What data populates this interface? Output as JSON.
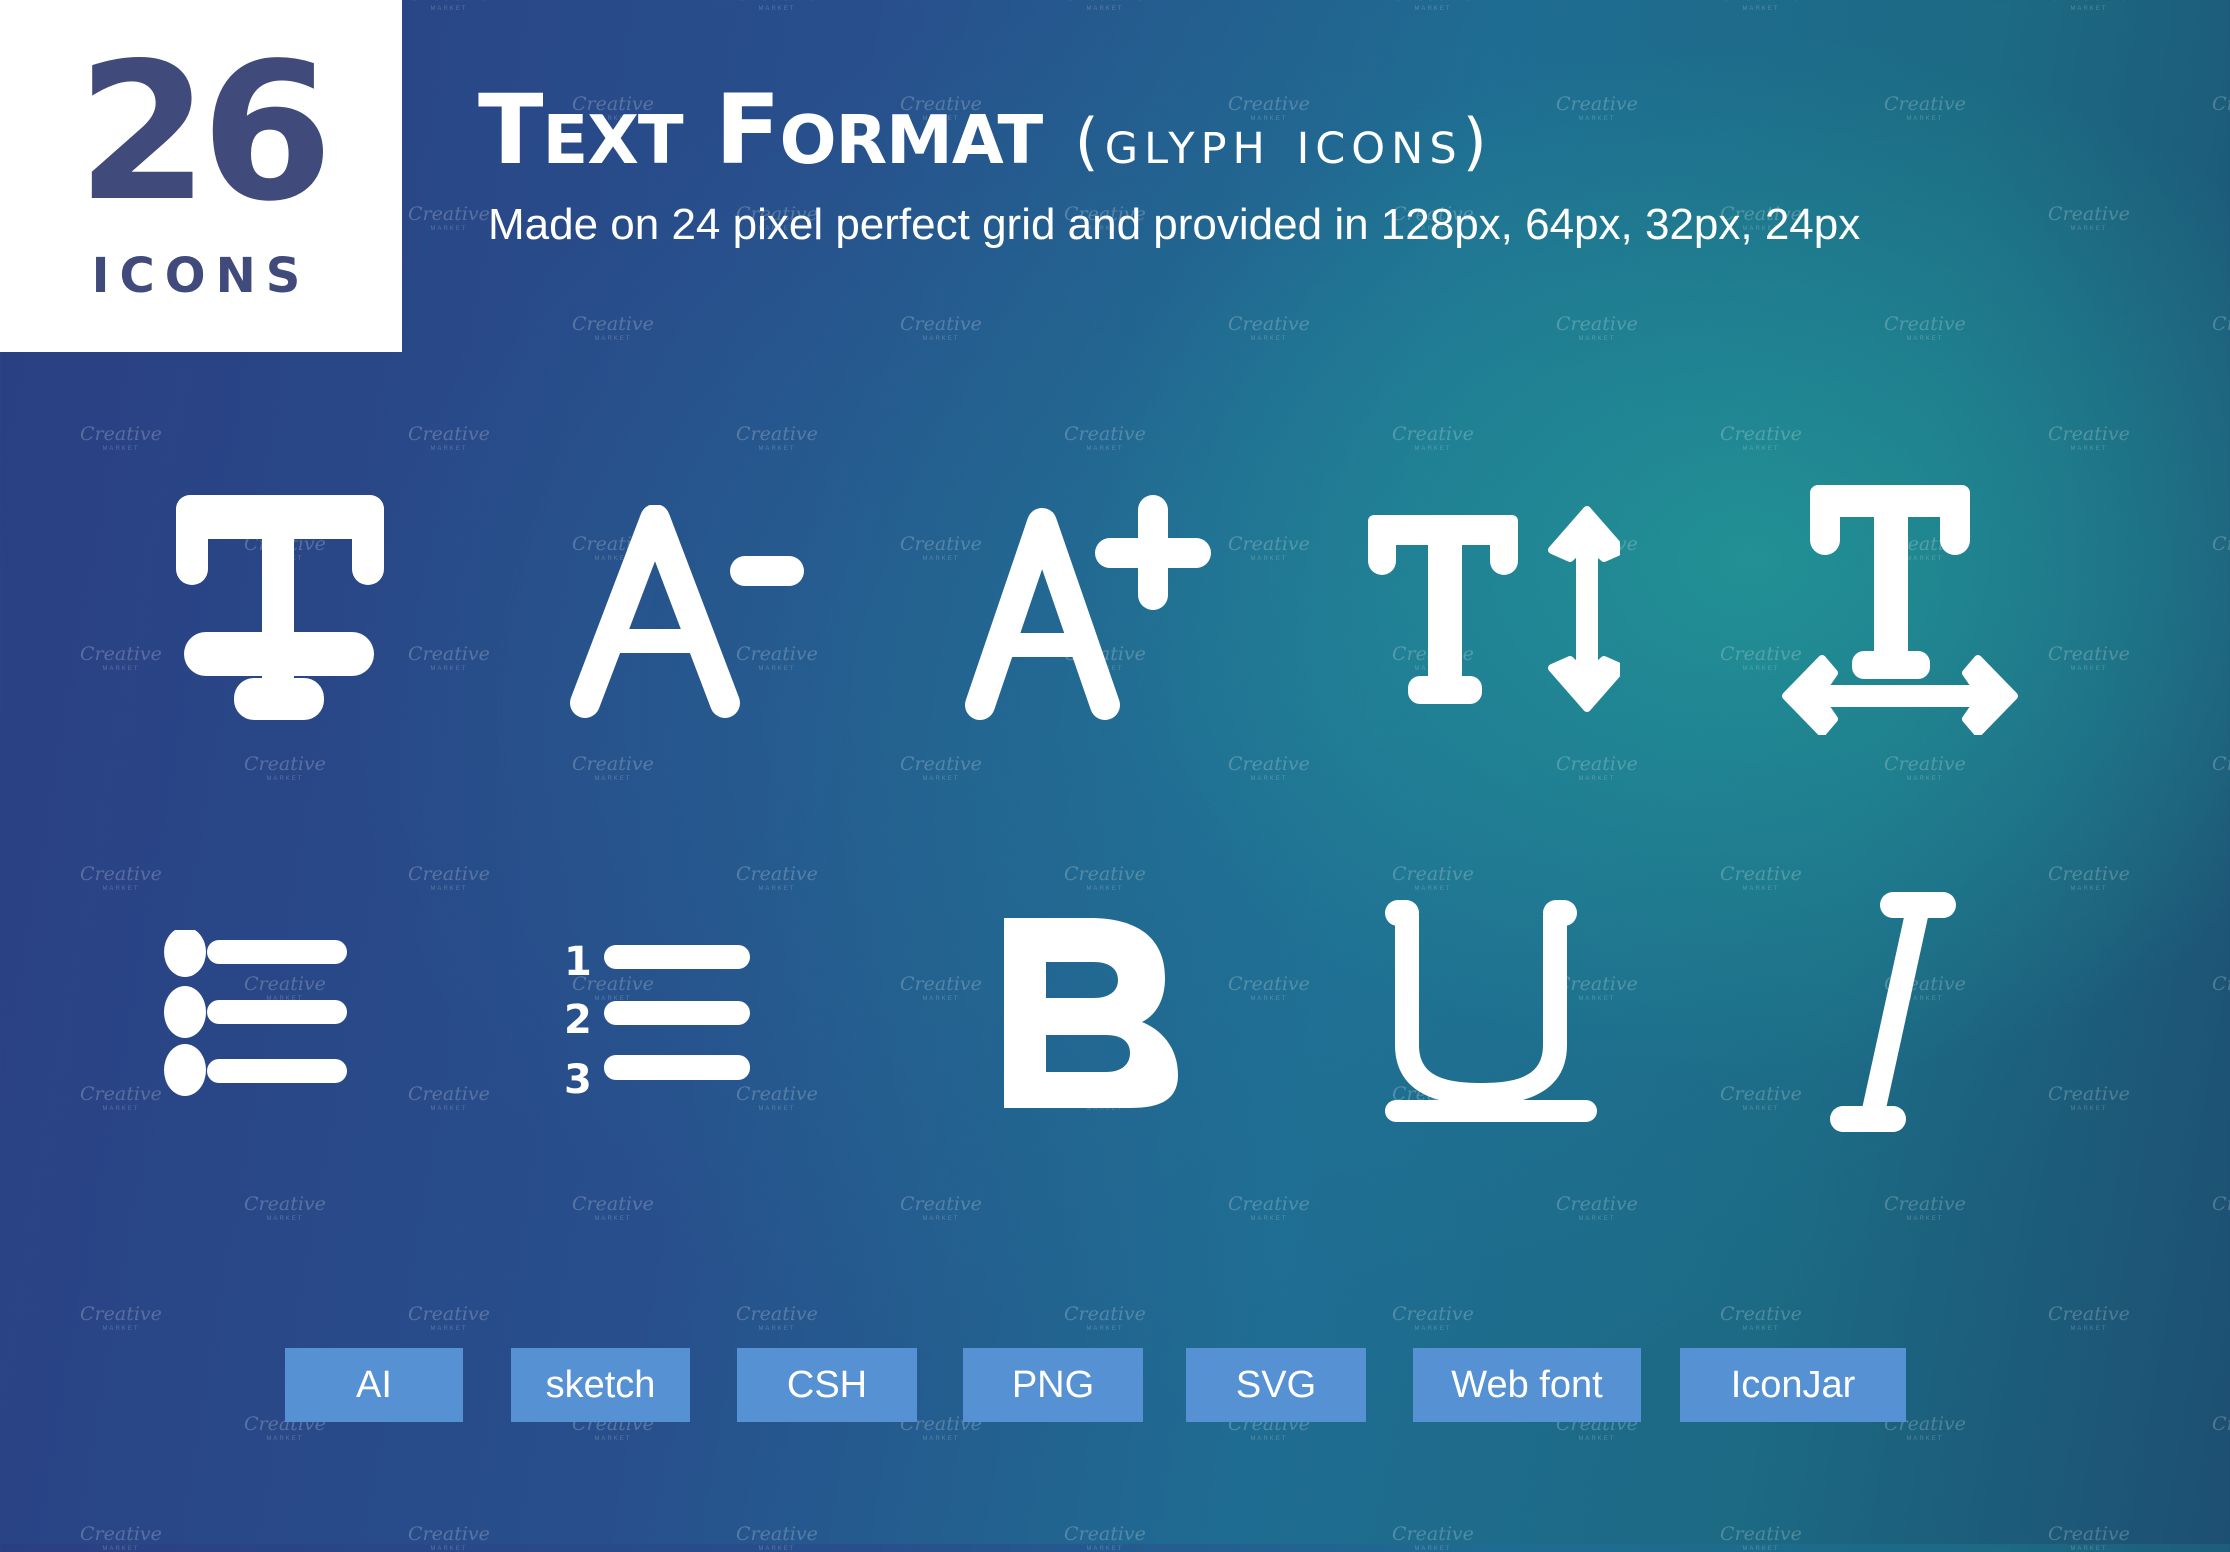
{
  "header": {
    "count": "26",
    "count_label": "ICONS",
    "title": "Text Format",
    "title_suffix": "(glyph icons)",
    "subtitle": "Made on 24 pixel perfect grid and provided in 128px, 64px, 32px, 24px"
  },
  "icons": [
    {
      "name": "strikethrough-icon"
    },
    {
      "name": "decrease-font-size-icon"
    },
    {
      "name": "increase-font-size-icon"
    },
    {
      "name": "text-height-icon"
    },
    {
      "name": "text-width-icon"
    },
    {
      "name": "bulleted-list-icon"
    },
    {
      "name": "numbered-list-icon",
      "numbers": [
        "1",
        "2",
        "3"
      ]
    },
    {
      "name": "bold-icon"
    },
    {
      "name": "underline-icon"
    },
    {
      "name": "italic-icon"
    }
  ],
  "formats": [
    "AI",
    "sketch",
    "CSH",
    "PNG",
    "SVG",
    "Web font",
    "IconJar"
  ],
  "watermark": {
    "text": "Creative",
    "sub": "MARKET"
  },
  "colors": {
    "logo_text": "#404b7c",
    "badge": "#5691d3",
    "icon": "#ffffff"
  }
}
